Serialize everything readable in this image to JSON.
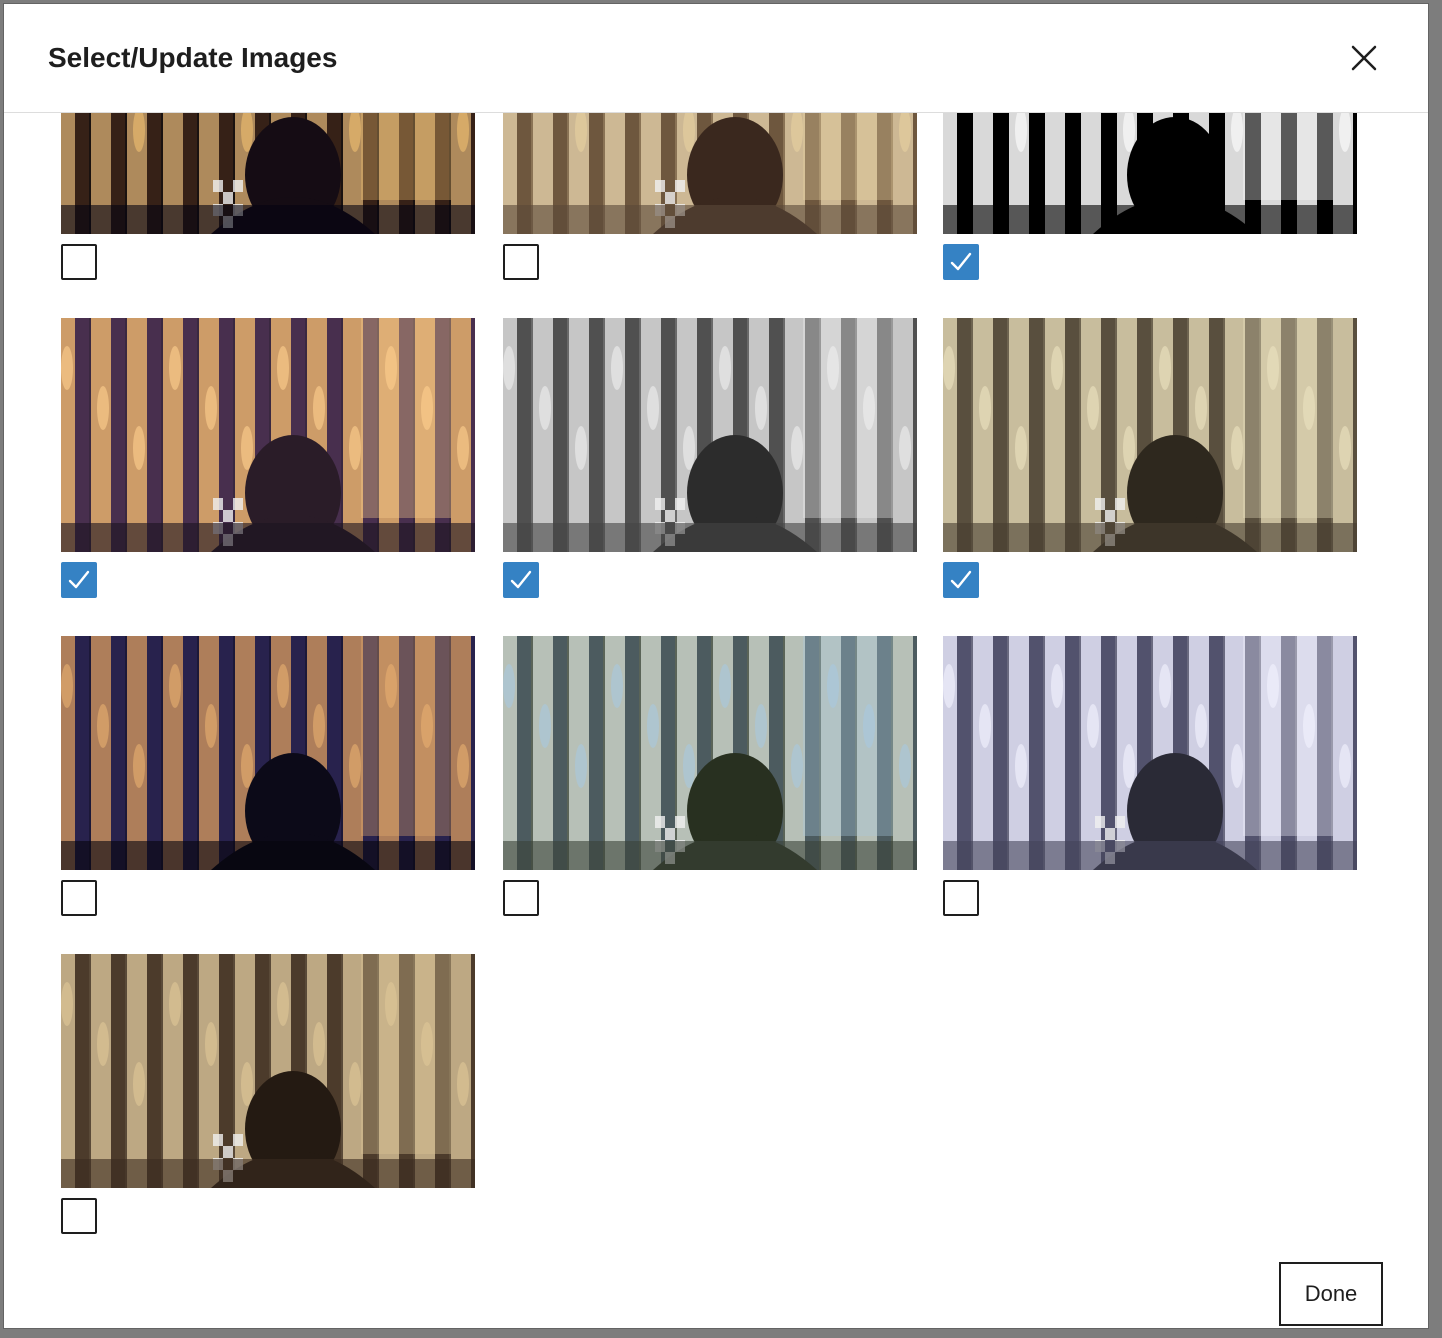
{
  "modal": {
    "title": "Select/Update Images",
    "close_label": "Close",
    "done_label": "Done"
  },
  "colors": {
    "accent": "#3582c4",
    "border": "#1e1e1e"
  },
  "images": [
    {
      "filter": "normal-dark",
      "checked": false
    },
    {
      "filter": "normal",
      "checked": false
    },
    {
      "filter": "threshold",
      "checked": true
    },
    {
      "filter": "warm-dark",
      "checked": true
    },
    {
      "filter": "grayscale",
      "checked": true
    },
    {
      "filter": "sepia",
      "checked": true
    },
    {
      "filter": "blue-dark",
      "checked": false
    },
    {
      "filter": "teal",
      "checked": false
    },
    {
      "filter": "lavender",
      "checked": false
    },
    {
      "filter": "vintage",
      "checked": false
    }
  ]
}
